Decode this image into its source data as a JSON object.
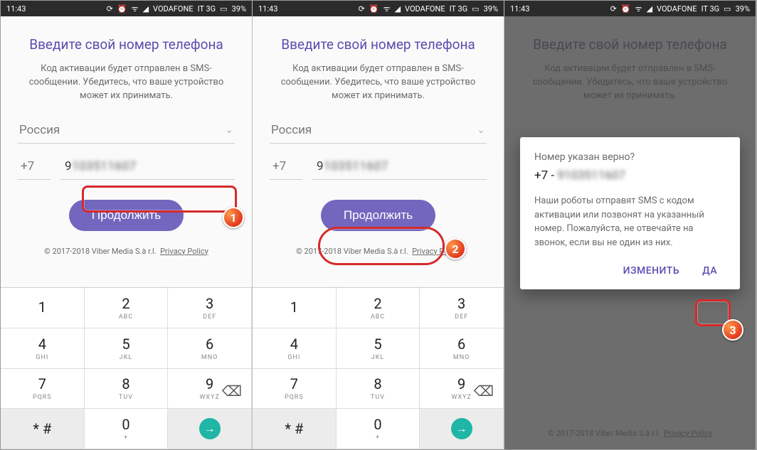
{
  "status": {
    "time": "11:43",
    "carrier": "VODAFONE",
    "network": "IT 3G",
    "battery": "39%"
  },
  "screen": {
    "title": "Введите свой номер телефона",
    "subtitle": "Код активации будет отправлен в SMS-сообщении. Убедитесь, что ваше устройство может их принимать.",
    "country": "Россия",
    "prefix": "+7",
    "number_visible": "9",
    "number_blurred": "103511607",
    "continue": "Продолжить",
    "footer_copy": "© 2017-2018 Viber Media S.à r.l.",
    "footer_pp": "Privacy Policy"
  },
  "keypad": [
    {
      "d": "1",
      "l": ""
    },
    {
      "d": "2",
      "l": "ABC"
    },
    {
      "d": "3",
      "l": "DEF"
    },
    {
      "d": "4",
      "l": "GHI"
    },
    {
      "d": "5",
      "l": "JKL"
    },
    {
      "d": "6",
      "l": "MNO"
    },
    {
      "d": "7",
      "l": "PQRS"
    },
    {
      "d": "8",
      "l": "TUV"
    },
    {
      "d": "9",
      "l": "WXYZ"
    },
    {
      "d": "* #",
      "l": ""
    },
    {
      "d": "0",
      "l": "+"
    },
    {
      "d": "go",
      "l": ""
    }
  ],
  "dialog": {
    "question": "Номер указан верно?",
    "number_prefix": "+7 - ",
    "number_blurred": "9103511607",
    "body": "Наши роботы отправят SMS с кодом активации или позвонят на указанный номер. Пожалуйста, не отвечайте на звонок, если вы не один из них.",
    "change": "ИЗМЕНИТЬ",
    "yes": "ДА"
  },
  "badges": {
    "b1": "1",
    "b2": "2",
    "b3": "3"
  }
}
